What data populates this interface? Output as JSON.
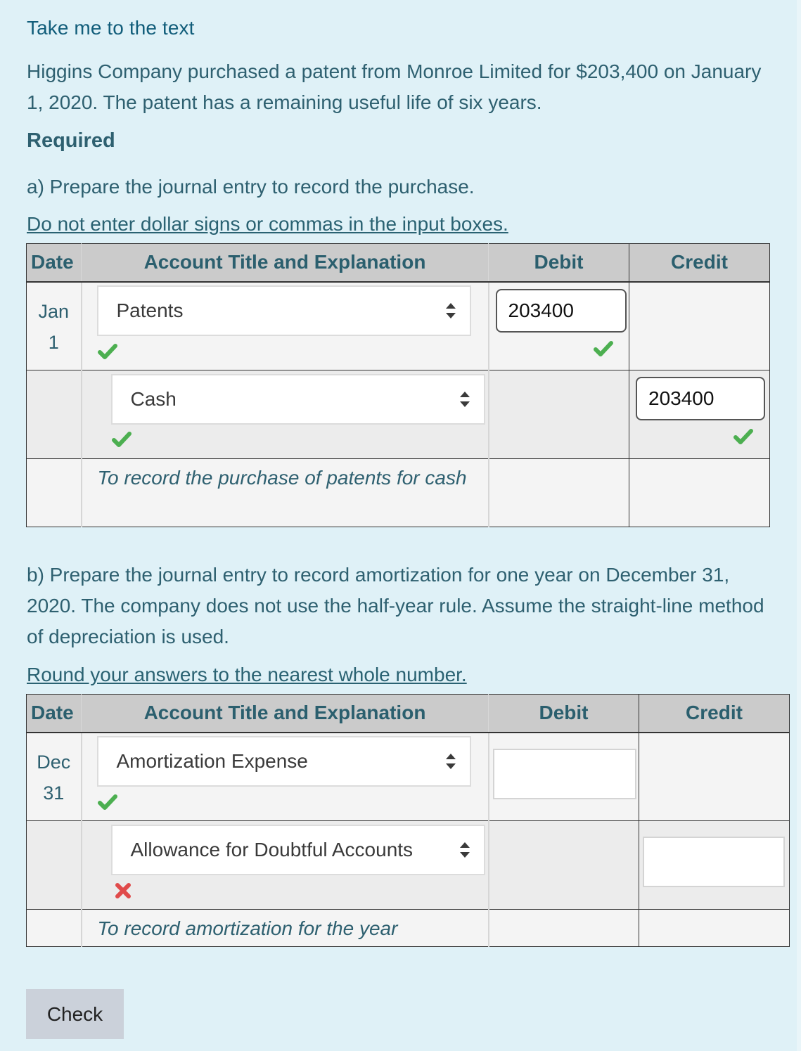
{
  "top_link": "Take me to the text",
  "problem_text": "Higgins Company purchased a patent from Monroe Limited for $203,400 on January 1, 2020. The patent has a remaining useful life of six years.",
  "required_heading": "Required",
  "part_a": {
    "instruction": "a) Prepare the journal entry to record the purchase.",
    "note": "Do not enter dollar signs or commas in the input boxes.",
    "headers": {
      "date": "Date",
      "account": "Account Title and Explanation",
      "debit": "Debit",
      "credit": "Credit"
    },
    "date_month": "Jan",
    "date_day": "1",
    "rows": [
      {
        "account": "Patents",
        "account_status": "correct",
        "debit": "203400",
        "debit_status": "correct",
        "credit": ""
      },
      {
        "account": "Cash",
        "account_status": "correct",
        "debit": "",
        "credit": "203400",
        "credit_status": "correct"
      }
    ],
    "explanation": "To record the purchase of patents for cash"
  },
  "part_b": {
    "instruction": "b) Prepare the journal entry to record amortization for one year on December 31, 2020. The company does not use the half-year rule. Assume the straight-line method of depreciation is used.",
    "note": "Round your answers to the nearest whole number.",
    "headers": {
      "date": "Date",
      "account": "Account Title and Explanation",
      "debit": "Debit",
      "credit": "Credit"
    },
    "date_month": "Dec",
    "date_day": "31",
    "rows": [
      {
        "account": "Amortization Expense",
        "account_status": "correct",
        "debit": "",
        "credit": ""
      },
      {
        "account": "Allowance for Doubtful Accounts",
        "account_status": "incorrect",
        "debit": "",
        "credit": ""
      }
    ],
    "explanation": "To record amortization for the year"
  },
  "check_button": "Check",
  "colors": {
    "correct": "#4caf50",
    "incorrect": "#e04b4b",
    "text": "#2e6070",
    "background": "#dff1f7"
  }
}
